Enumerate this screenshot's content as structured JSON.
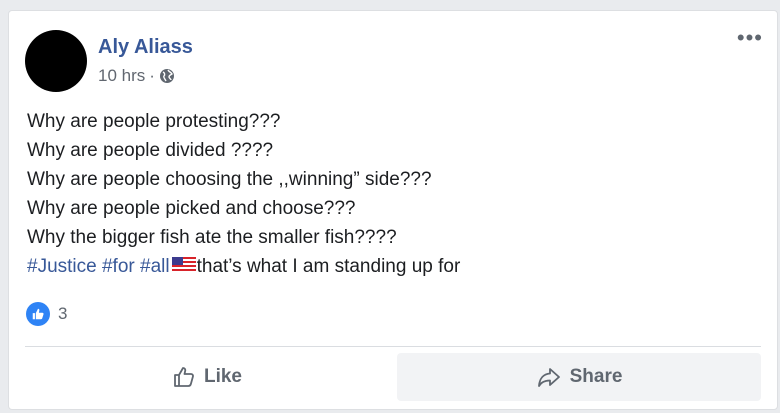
{
  "post": {
    "author": "Aly Aliass",
    "time": "10 hrs",
    "separator": "·",
    "more_label": "•••",
    "lines": [
      "Why are people protesting???",
      "Why are people divided ????",
      "Why are people choosing the ,,winning” side???",
      "Why are people picked and choose???",
      "Why the bigger fish ate the smaller fish????"
    ],
    "hashtags": [
      "#Justice",
      "#for",
      "#all"
    ],
    "closing_text": "that’s what I am standing up for",
    "reaction_count": "3"
  },
  "actions": {
    "like_label": "Like",
    "share_label": "Share"
  },
  "colors": {
    "link": "#385898",
    "like_blue": "#2e83f5",
    "text": "#1c1e21",
    "muted": "#606770"
  },
  "icons": {
    "privacy": "globe-icon",
    "reaction": "like-reaction-icon",
    "like": "thumbs-up-icon",
    "share": "share-arrow-icon",
    "flag": "us-flag-emoji"
  }
}
